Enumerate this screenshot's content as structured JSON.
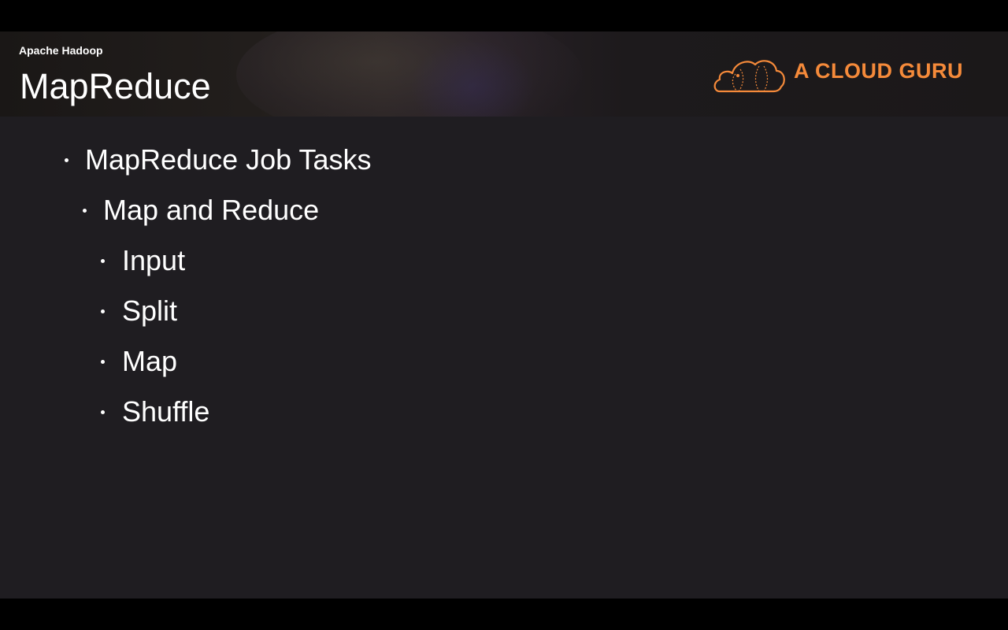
{
  "header": {
    "subtitle": "Apache Hadoop",
    "title": "MapReduce"
  },
  "logo": {
    "text": "A CLOUD GURU",
    "icon": "cloud-logo-icon",
    "color": "#f58a3a"
  },
  "bullets": [
    {
      "level": 1,
      "text": "MapReduce Job Tasks"
    },
    {
      "level": 2,
      "text": "Map and Reduce"
    },
    {
      "level": 3,
      "text": "Input"
    },
    {
      "level": 3,
      "text": "Split"
    },
    {
      "level": 3,
      "text": "Map"
    },
    {
      "level": 3,
      "text": "Shuffle"
    }
  ],
  "colors": {
    "slide_background": "#1f1d21",
    "text": "#ffffff",
    "accent": "#f58a3a"
  }
}
